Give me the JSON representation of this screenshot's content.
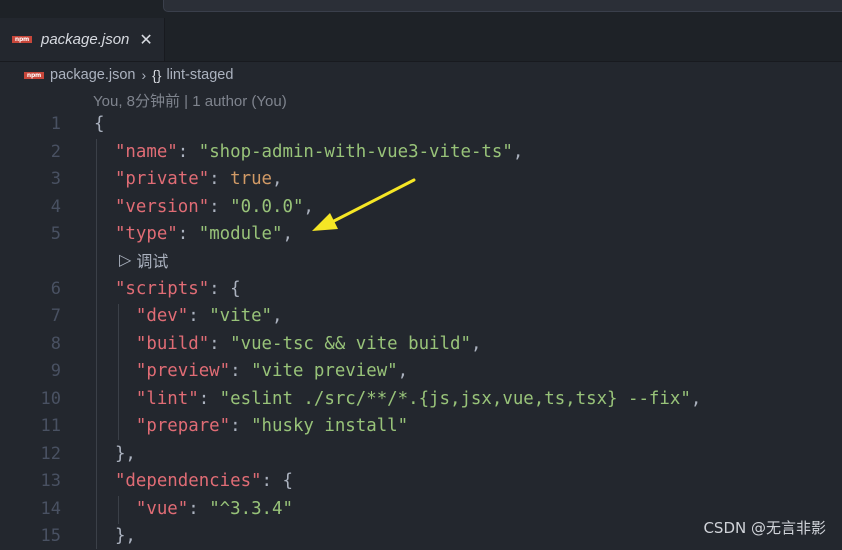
{
  "tab": {
    "label": "package.json",
    "close": "✕",
    "icon": "npm-icon"
  },
  "breadcrumb": {
    "file": "package.json",
    "separator": "›",
    "symbol_icon": "{}",
    "symbol": "lint-staged"
  },
  "blame": "You, 8分钟前 | 1 author (You)",
  "codelens": {
    "icon": "▷",
    "label": "调试"
  },
  "lines": [
    {
      "n": "1",
      "parts": [
        [
          "p",
          "{"
        ]
      ]
    },
    {
      "n": "2",
      "parts": [
        [
          "k",
          "\"name\""
        ],
        [
          "p",
          ": "
        ],
        [
          "s",
          "\"shop-admin-with-vue3-vite-ts\""
        ],
        [
          "p",
          ","
        ]
      ]
    },
    {
      "n": "3",
      "parts": [
        [
          "k",
          "\"private\""
        ],
        [
          "p",
          ": "
        ],
        [
          "b",
          "true"
        ],
        [
          "p",
          ","
        ]
      ]
    },
    {
      "n": "4",
      "parts": [
        [
          "k",
          "\"version\""
        ],
        [
          "p",
          ": "
        ],
        [
          "s",
          "\"0.0.0\""
        ],
        [
          "p",
          ","
        ]
      ]
    },
    {
      "n": "5",
      "parts": [
        [
          "k",
          "\"type\""
        ],
        [
          "p",
          ": "
        ],
        [
          "s",
          "\"module\""
        ],
        [
          "p",
          ","
        ]
      ]
    },
    {
      "n": "6",
      "parts": [
        [
          "k",
          "\"scripts\""
        ],
        [
          "p",
          ": {"
        ]
      ]
    },
    {
      "n": "7",
      "parts": [
        [
          "k",
          "\"dev\""
        ],
        [
          "p",
          ": "
        ],
        [
          "s",
          "\"vite\""
        ],
        [
          "p",
          ","
        ]
      ]
    },
    {
      "n": "8",
      "parts": [
        [
          "k",
          "\"build\""
        ],
        [
          "p",
          ": "
        ],
        [
          "s",
          "\"vue-tsc && vite build\""
        ],
        [
          "p",
          ","
        ]
      ]
    },
    {
      "n": "9",
      "parts": [
        [
          "k",
          "\"preview\""
        ],
        [
          "p",
          ": "
        ],
        [
          "s",
          "\"vite preview\""
        ],
        [
          "p",
          ","
        ]
      ]
    },
    {
      "n": "10",
      "parts": [
        [
          "k",
          "\"lint\""
        ],
        [
          "p",
          ": "
        ],
        [
          "s",
          "\"eslint ./src/**/*.{js,jsx,vue,ts,tsx} --fix\""
        ],
        [
          "p",
          ","
        ]
      ]
    },
    {
      "n": "11",
      "parts": [
        [
          "k",
          "\"prepare\""
        ],
        [
          "p",
          ": "
        ],
        [
          "s",
          "\"husky install\""
        ]
      ]
    },
    {
      "n": "12",
      "parts": [
        [
          "p",
          "},"
        ]
      ]
    },
    {
      "n": "13",
      "parts": [
        [
          "k",
          "\"dependencies\""
        ],
        [
          "p",
          ": {"
        ]
      ]
    },
    {
      "n": "14",
      "parts": [
        [
          "k",
          "\"vue\""
        ],
        [
          "p",
          ": "
        ],
        [
          "s",
          "\"^3.3.4\""
        ]
      ]
    },
    {
      "n": "15",
      "parts": [
        [
          "p",
          "},"
        ]
      ]
    }
  ],
  "watermark": "CSDN @无言非影",
  "colors": {
    "key": "#e06c75",
    "string": "#98c379",
    "boolean": "#d19a66",
    "arrow": "#f5e625"
  }
}
